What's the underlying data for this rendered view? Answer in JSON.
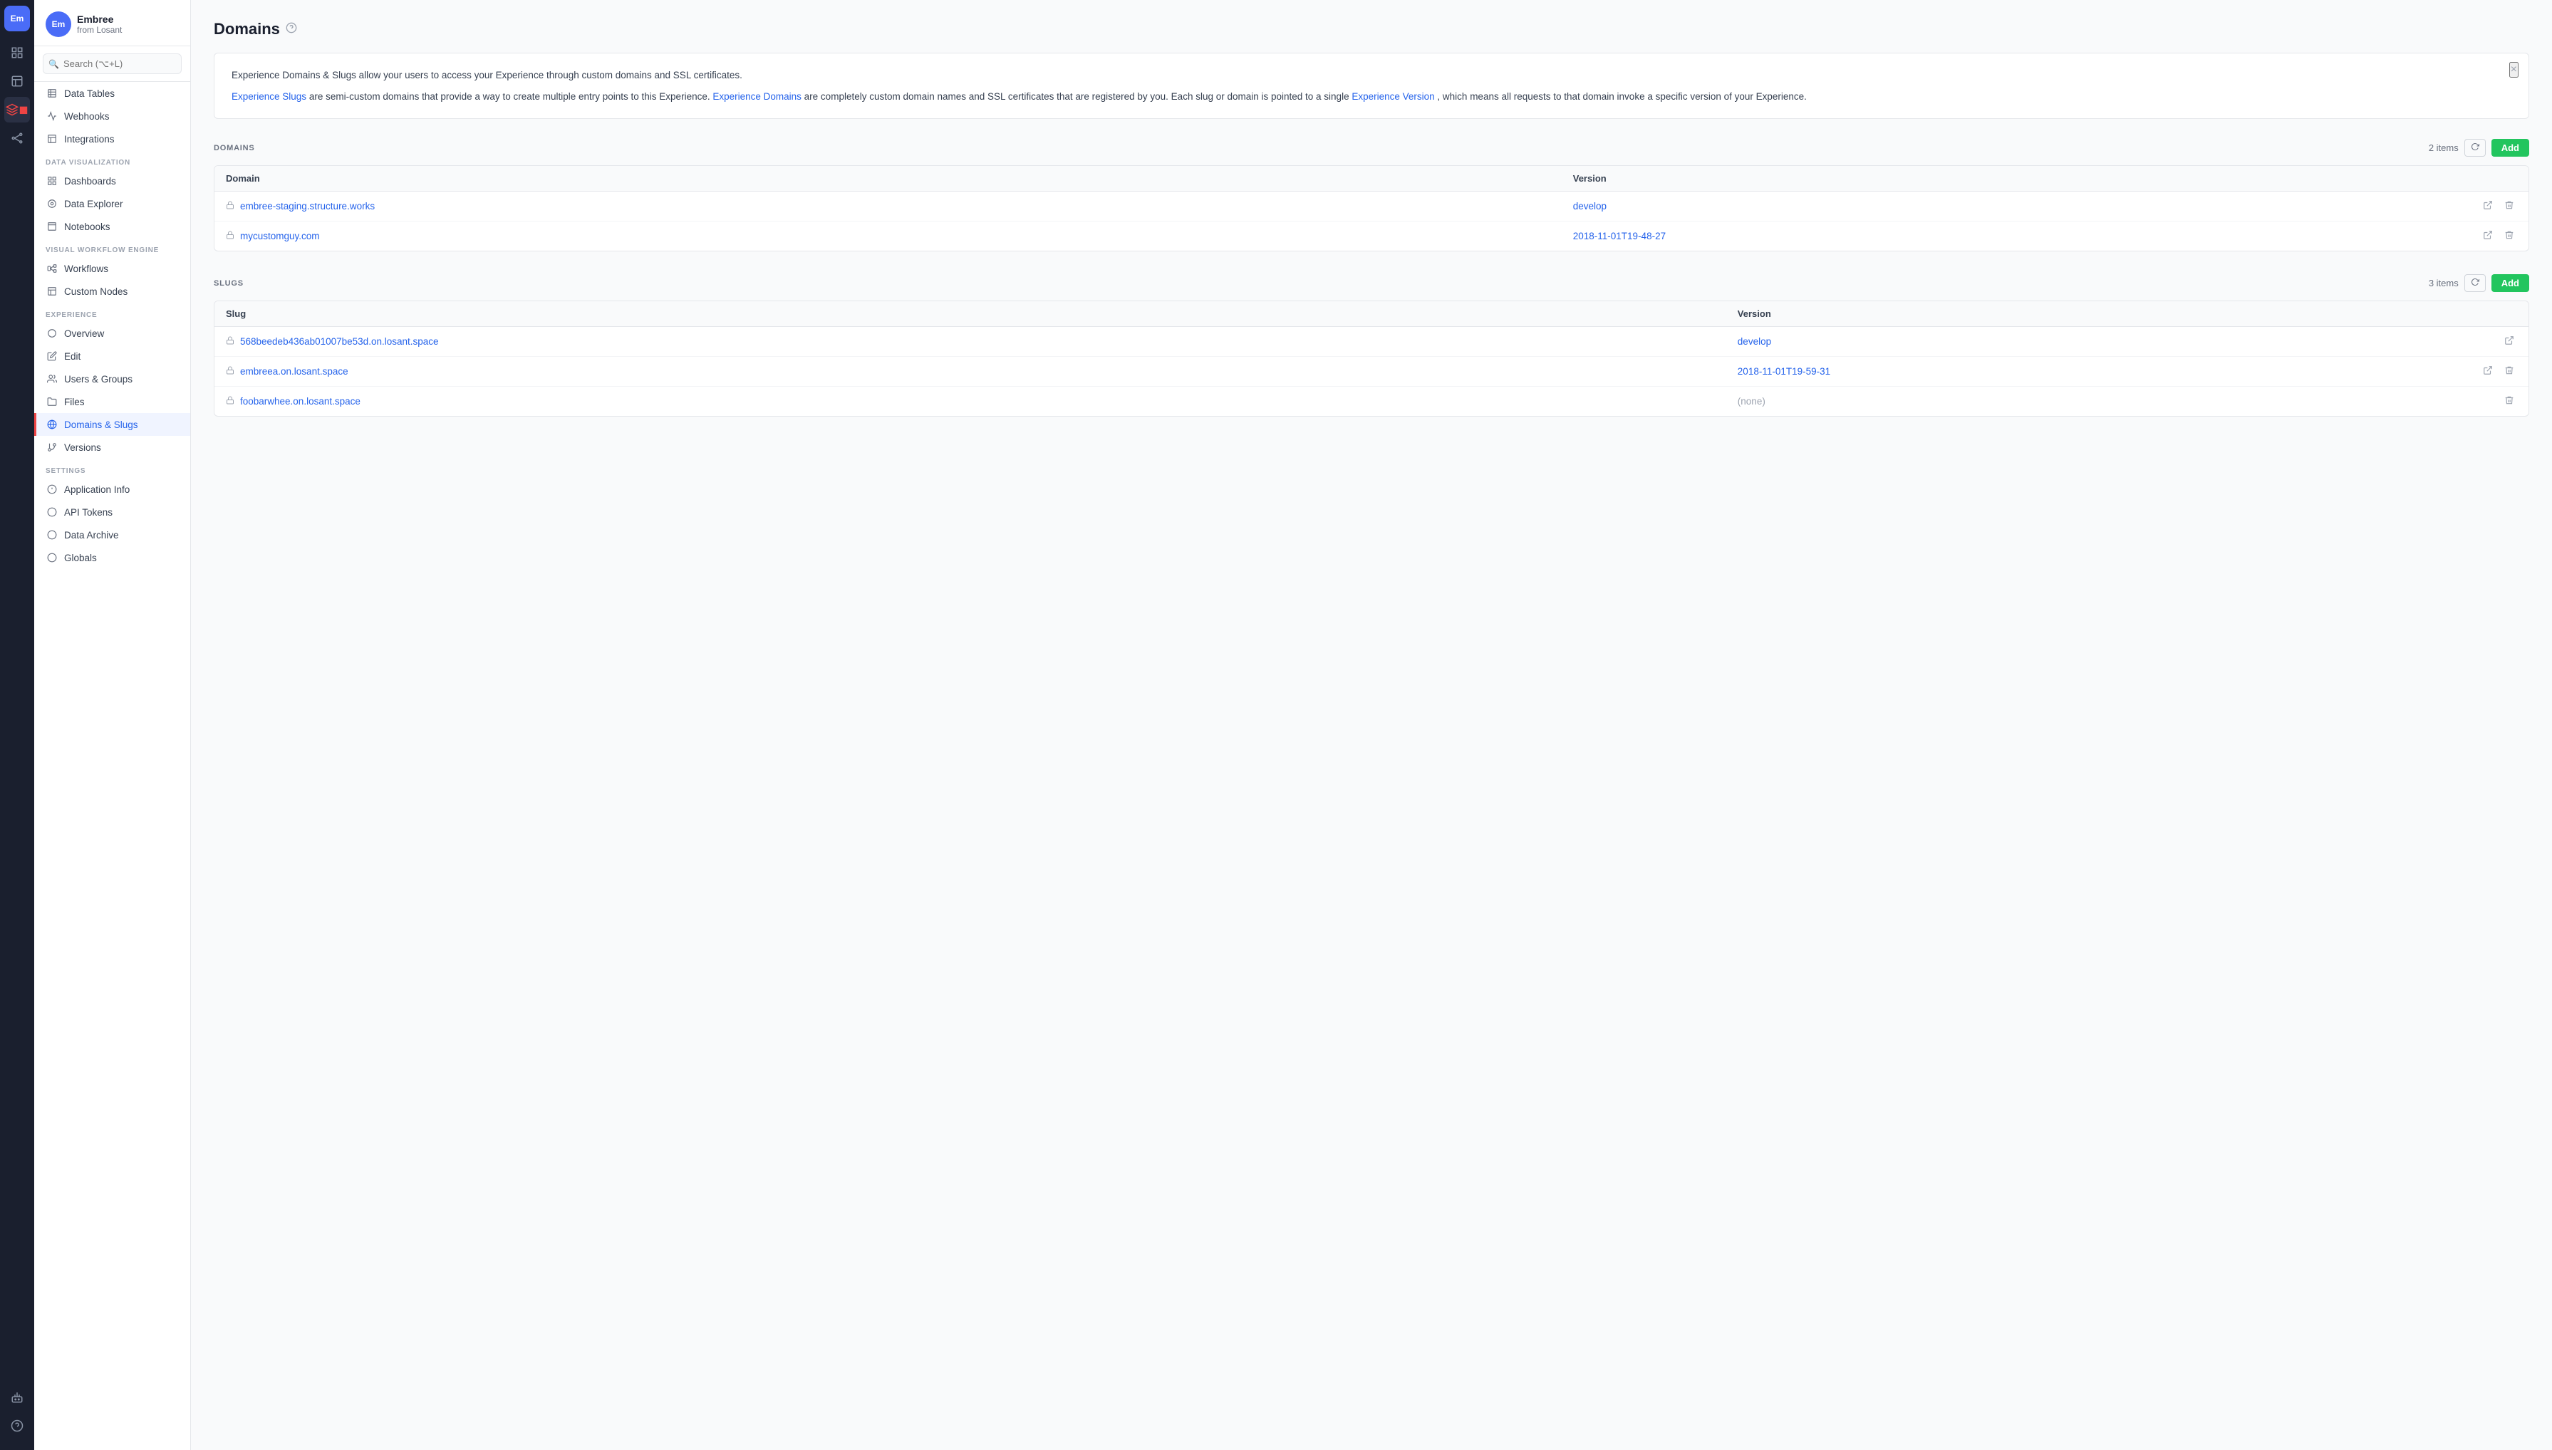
{
  "iconBar": {
    "brand": "Em",
    "items": [
      {
        "name": "nav-home",
        "icon": "⊞",
        "active": false
      },
      {
        "name": "nav-dashboard",
        "icon": "▦",
        "active": false
      },
      {
        "name": "nav-box",
        "icon": "◫",
        "active": true
      },
      {
        "name": "nav-workflow",
        "icon": "⟳",
        "active": false
      },
      {
        "name": "nav-nodes",
        "icon": "✦",
        "active": false
      }
    ],
    "bottom": [
      {
        "name": "nav-robot",
        "icon": "⚙"
      },
      {
        "name": "nav-help",
        "icon": "?"
      }
    ]
  },
  "sidebar": {
    "org": {
      "avatar": "Em",
      "name": "Embree",
      "sub": "from Losant"
    },
    "search": {
      "placeholder": "Search (⌥+L)"
    },
    "sections": [
      {
        "label": "",
        "items": [
          {
            "name": "data-tables",
            "icon": "▦",
            "label": "Data Tables"
          },
          {
            "name": "webhooks",
            "icon": "↗",
            "label": "Webhooks"
          },
          {
            "name": "integrations",
            "icon": "▤",
            "label": "Integrations"
          }
        ]
      },
      {
        "label": "Data Visualization",
        "items": [
          {
            "name": "dashboards",
            "icon": "▦",
            "label": "Dashboards"
          },
          {
            "name": "data-explorer",
            "icon": "◎",
            "label": "Data Explorer"
          },
          {
            "name": "notebooks",
            "icon": "▭",
            "label": "Notebooks"
          }
        ]
      },
      {
        "label": "Visual Workflow Engine",
        "items": [
          {
            "name": "workflows",
            "icon": "⚡",
            "label": "Workflows"
          },
          {
            "name": "custom-nodes",
            "icon": "▦",
            "label": "Custom Nodes"
          }
        ]
      },
      {
        "label": "Experience",
        "items": [
          {
            "name": "overview",
            "icon": "◎",
            "label": "Overview"
          },
          {
            "name": "edit",
            "icon": "✎",
            "label": "Edit"
          },
          {
            "name": "users-groups",
            "icon": "👥",
            "label": "Users & Groups"
          },
          {
            "name": "files",
            "icon": "▭",
            "label": "Files"
          },
          {
            "name": "domains-slugs",
            "icon": "🌐",
            "label": "Domains & Slugs",
            "active": true
          },
          {
            "name": "versions",
            "icon": "⎇",
            "label": "Versions"
          }
        ]
      },
      {
        "label": "Settings",
        "items": [
          {
            "name": "application-info",
            "icon": "◎",
            "label": "Application Info"
          },
          {
            "name": "api-tokens",
            "icon": "◎",
            "label": "API Tokens"
          },
          {
            "name": "data-archive",
            "icon": "◎",
            "label": "Data Archive"
          },
          {
            "name": "globals",
            "icon": "◎",
            "label": "Globals"
          }
        ]
      }
    ]
  },
  "page": {
    "title": "Domains",
    "helpIcon": "?"
  },
  "infoBanner": {
    "text1": "Experience Domains & Slugs allow your users to access your Experience through custom domains and SSL certificates.",
    "text2parts": [
      {
        "text": "Experience Slugs",
        "link": true
      },
      {
        "text": " are semi-custom domains that provide a way to create multiple entry points to this Experience. ",
        "link": false
      },
      {
        "text": "Experience Domains",
        "link": true
      },
      {
        "text": " are completely custom domain names and SSL certificates that are registered by you. Each slug or domain is pointed to a single ",
        "link": false
      },
      {
        "text": "Experience Version",
        "link": true
      },
      {
        "text": ", which means all requests to that domain invoke a specific version of your Experience.",
        "link": false
      }
    ]
  },
  "domainsSection": {
    "title": "DOMAINS",
    "count": "2 items",
    "addLabel": "Add",
    "refreshLabel": "↻",
    "columns": [
      "Domain",
      "Version"
    ],
    "rows": [
      {
        "domain": "embree-staging.structure.works",
        "version": "develop",
        "versionLink": true
      },
      {
        "domain": "mycustomguy.com",
        "version": "2018-11-01T19-48-27",
        "versionLink": true
      }
    ]
  },
  "slugsSection": {
    "title": "SLUGS",
    "count": "3 items",
    "addLabel": "Add",
    "refreshLabel": "↻",
    "columns": [
      "Slug",
      "Version"
    ],
    "rows": [
      {
        "slug": "568beedeb436ab01007be53d.on.losant.space",
        "version": "develop",
        "versionLink": true
      },
      {
        "slug": "embreea.on.losant.space",
        "version": "2018-11-01T19-59-31",
        "versionLink": true
      },
      {
        "slug": "foobarwhee.on.losant.space",
        "version": "(none)",
        "versionLink": false
      }
    ]
  }
}
